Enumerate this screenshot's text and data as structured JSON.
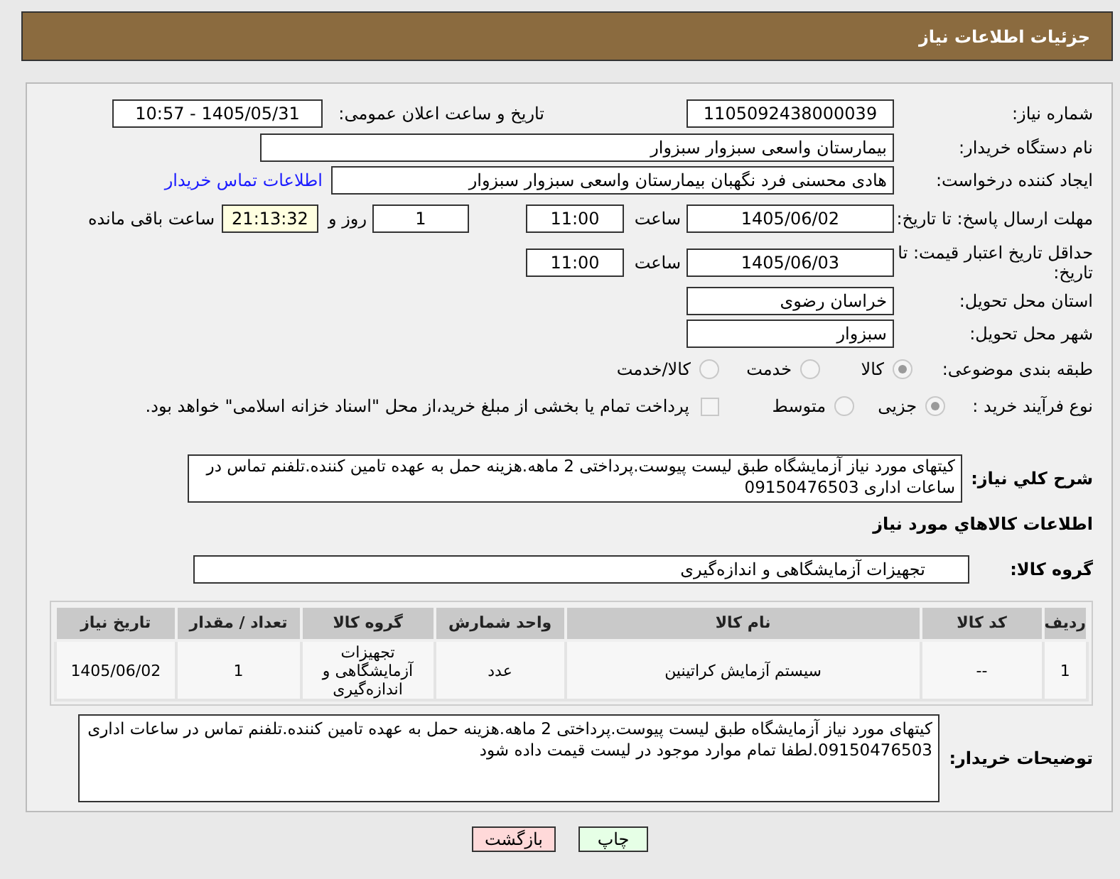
{
  "header": {
    "title": "جزئیات اطلاعات نیاز"
  },
  "need_number": {
    "label": "شماره نیاز:",
    "value": "1105092438000039"
  },
  "announce": {
    "label": "تاریخ و ساعت اعلان عمومی:",
    "value": "1405/05/31 - 10:57"
  },
  "buyer_org": {
    "label": "نام دستگاه خریدار:",
    "value": "بیمارستان واسعی سبزوار سبزوار"
  },
  "requester": {
    "label": "ایجاد کننده درخواست:",
    "value": "هادی محسنی فرد نگهبان بیمارستان واسعی سبزوار سبزوار",
    "link": "اطلاعات تماس خریدار"
  },
  "response_deadline": {
    "label": "مهلت ارسال پاسخ: تا تاریخ:",
    "date": "1405/06/02",
    "time_label": "ساعت",
    "time": "11:00",
    "days": "1",
    "days_label": "روز و",
    "remaining": "21:13:32",
    "remaining_label": "ساعت باقی مانده"
  },
  "price_validity": {
    "label": "حداقل تاریخ اعتبار قیمت: تا تاریخ:",
    "date": "1405/06/03",
    "time_label": "ساعت",
    "time": "11:00"
  },
  "province": {
    "label": "استان محل تحویل:",
    "value": "خراسان رضوی"
  },
  "city": {
    "label": "شهر محل تحویل:",
    "value": "سبزوار"
  },
  "category": {
    "label": "طبقه بندی موضوعی:",
    "options": [
      {
        "label": "کالا",
        "selected": true
      },
      {
        "label": "خدمت",
        "selected": false
      },
      {
        "label": "کالا/خدمت",
        "selected": false
      }
    ]
  },
  "purchase_process": {
    "label": "نوع فرآیند خرید :",
    "options": [
      {
        "label": "جزیی",
        "selected": true
      },
      {
        "label": "متوسط",
        "selected": false
      }
    ],
    "treasury_payment": {
      "label": "پرداخت تمام یا بخشی از مبلغ خرید،از محل \"اسناد خزانه اسلامی\" خواهد بود.",
      "checked": false
    }
  },
  "description": {
    "label": "شرح کلي نیاز:",
    "value": "کیتهای مورد نیاز آزمایشگاه طبق لیست پیوست.پرداختی 2 ماهه.هزینه حمل به عهده تامین کننده.تلفنم تماس در ساعات اداری 09150476503"
  },
  "goods_heading": "اطلاعات کالاهاي مورد نیاز",
  "goods_group": {
    "label": "گروه کالا:",
    "value": "تجهیزات آزمایشگاهی و اندازه‌گیری"
  },
  "table": {
    "columns": [
      "ردیف",
      "کد کالا",
      "نام کالا",
      "واحد شمارش",
      "گروه کالا",
      "تعداد / مقدار",
      "تاریخ نیاز"
    ],
    "rows": [
      [
        "1",
        "--",
        "سیستم آزمایش کراتینین",
        "عدد",
        "تجهیزات آزمایشگاهی و اندازه‌گیری",
        "1",
        "1405/06/02"
      ]
    ]
  },
  "buyer_notes": {
    "label": "توضیحات خریدار:",
    "value": "کیتهای مورد نیاز آزمایشگاه طبق لیست پیوست.پرداختی 2 ماهه.هزینه حمل به عهده تامین کننده.تلفنم تماس در ساعات اداری 09150476503.لطفا تمام موارد موجود در لیست قیمت داده شود"
  },
  "buttons": [
    {
      "label": "چاپ",
      "kind": "print"
    },
    {
      "label": "بازگشت",
      "kind": "back"
    }
  ]
}
